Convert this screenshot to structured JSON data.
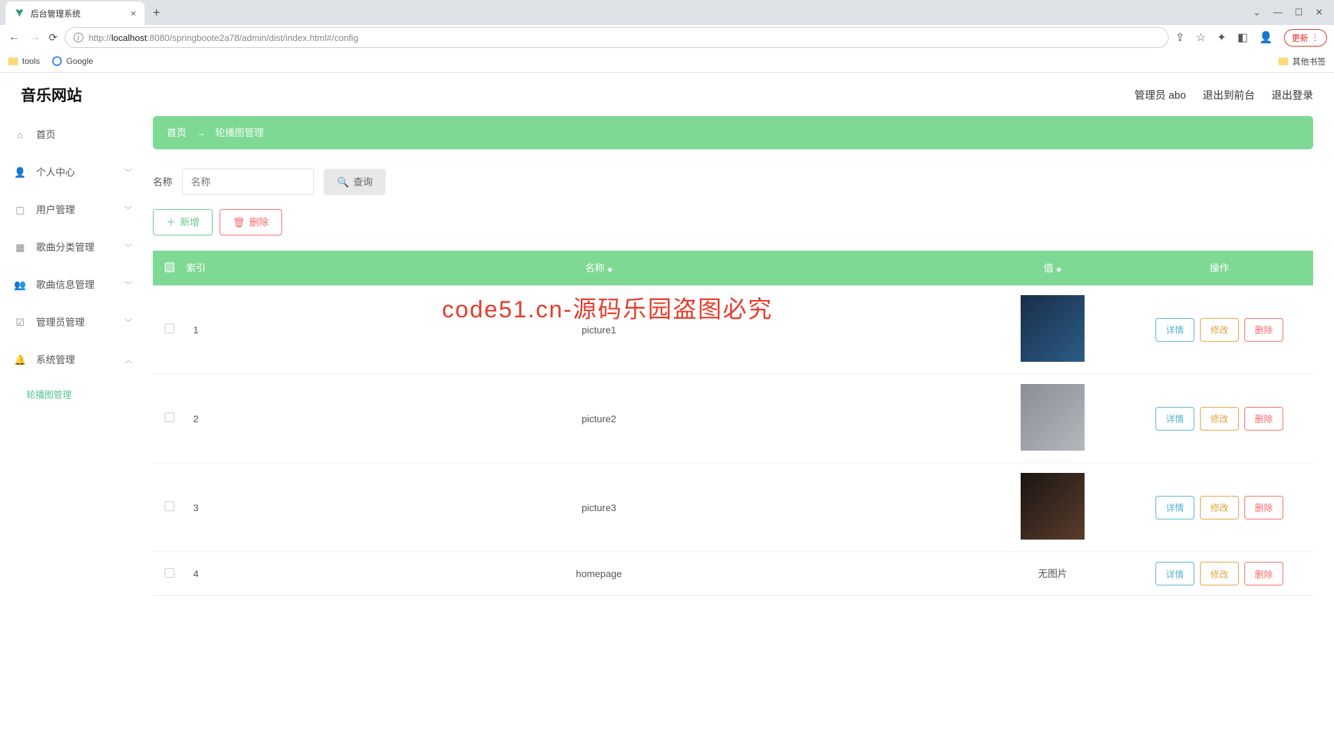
{
  "browser": {
    "tab_title": "后台管理系统",
    "url_prefix": "http://",
    "url_host": "localhost",
    "url_rest": ":8080/springboote2a78/admin/dist/index.html#/config",
    "update_btn": "更新",
    "bookmarks": {
      "tools": "tools",
      "google": "Google",
      "other": "其他书签"
    }
  },
  "header": {
    "brand": "音乐网站",
    "admin": "管理员 abo",
    "to_front": "退出到前台",
    "logout": "退出登录"
  },
  "sidebar": {
    "items": [
      {
        "label": "首页",
        "icon": "home"
      },
      {
        "label": "个人中心",
        "icon": "user",
        "expand": true
      },
      {
        "label": "用户管理",
        "icon": "clipboard",
        "expand": true
      },
      {
        "label": "歌曲分类管理",
        "icon": "grid",
        "expand": true
      },
      {
        "label": "歌曲信息管理",
        "icon": "user2",
        "expand": true
      },
      {
        "label": "管理员管理",
        "icon": "check",
        "expand": true
      },
      {
        "label": "系统管理",
        "icon": "bell",
        "expand": true,
        "open": true
      }
    ],
    "sub_active": "轮播图管理"
  },
  "breadcrumb": {
    "home": "首页",
    "arrow": "→",
    "current": "轮播图管理"
  },
  "search": {
    "label": "名称",
    "placeholder": "名称",
    "query_btn": "查询"
  },
  "actions": {
    "add": "新增",
    "delete": "删除"
  },
  "table": {
    "headers": {
      "index": "索引",
      "name": "名称",
      "value": "值",
      "ops": "操作"
    },
    "rows": [
      {
        "idx": "1",
        "name": "picture1",
        "value_type": "img",
        "img_class": "t1"
      },
      {
        "idx": "2",
        "name": "picture2",
        "value_type": "img",
        "img_class": "t2"
      },
      {
        "idx": "3",
        "name": "picture3",
        "value_type": "img",
        "img_class": "t3"
      },
      {
        "idx": "4",
        "name": "homepage",
        "value_type": "text",
        "value_text": "无图片"
      }
    ],
    "ops": {
      "detail": "详情",
      "edit": "修改",
      "del": "删除"
    }
  },
  "watermark": "code51.cn",
  "red_watermark": "code51.cn-源码乐园盗图必究"
}
